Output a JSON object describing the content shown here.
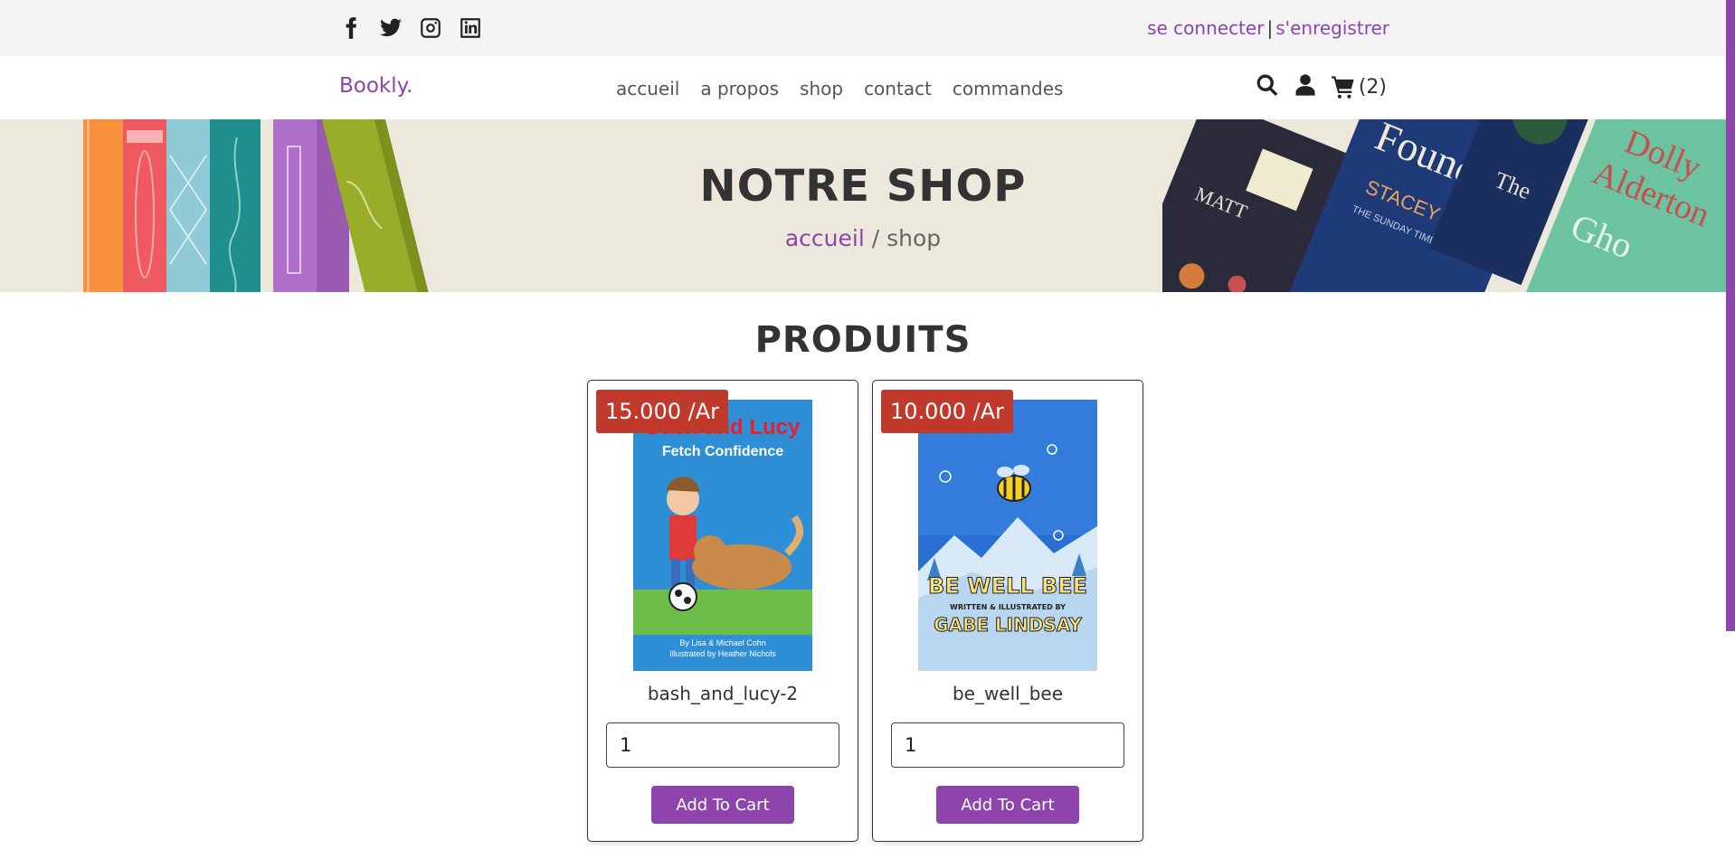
{
  "topbar": {
    "socials": [
      "facebook-icon",
      "twitter-icon",
      "instagram-icon",
      "linkedin-icon"
    ],
    "login": "se connecter",
    "separator": "|",
    "register": "s'enregistrer"
  },
  "header": {
    "logo": "Bookly.",
    "nav": [
      "accueil",
      "a propos",
      "shop",
      "contact",
      "commandes"
    ],
    "cart_count": "(2)"
  },
  "banner": {
    "title": "NOTRE SHOP",
    "crumb_home": "accueil",
    "crumb_rest": " / shop"
  },
  "products": {
    "title": "PRODUITS",
    "items": [
      {
        "price": "15.000 /Ar",
        "name": "bash_and_lucy-2",
        "qty": "1",
        "button": "Add To Cart",
        "cover_title": "Bash and Lucy",
        "cover_subtitle": "Fetch Confidence",
        "cover_credit1": "By Lisa & Michael Cohn",
        "cover_credit2": "Illustrated by Heather Nichols"
      },
      {
        "price": "10.000 /Ar",
        "name": "be_well_bee",
        "qty": "1",
        "button": "Add To Cart",
        "cover_title": "BE WELL BEE",
        "cover_subtitle": "WRITTEN & ILLUSTRATED BY",
        "cover_author": "GABE LINDSAY"
      }
    ]
  },
  "colors": {
    "accent": "#8e44ad",
    "price_badge": "#c0392b",
    "topbar_bg": "#f4f4f4",
    "banner_bg": "#ece9dc"
  }
}
